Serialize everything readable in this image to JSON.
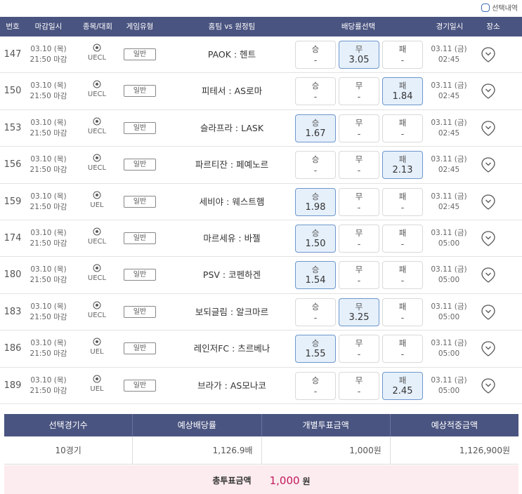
{
  "topbar": {
    "selection_label": "선택내역"
  },
  "header": {
    "no": "번호",
    "deadline": "마감일시",
    "sport": "종목/대회",
    "game_type": "게임유형",
    "teams": "홈팀 vs 원정팀",
    "odds": "배당률선택",
    "game_time": "경기일시",
    "venue": "장소"
  },
  "rows": [
    {
      "no": "147",
      "deadline_date": "03.10 (목)",
      "deadline_time": "21:50 마감",
      "league": "UECL",
      "type": "일반",
      "match": "PAOK : 헨트",
      "win_label": "승",
      "win_val": "-",
      "draw_label": "무",
      "draw_val": "3.05",
      "lose_label": "패",
      "lose_val": "-",
      "selected": "draw",
      "game_date": "03.11 (금)",
      "game_time": "02:45"
    },
    {
      "no": "150",
      "deadline_date": "03.10 (목)",
      "deadline_time": "21:50 마감",
      "league": "UECL",
      "type": "일반",
      "match": "피테서 : AS로마",
      "win_label": "승",
      "win_val": "-",
      "draw_label": "무",
      "draw_val": "-",
      "lose_label": "패",
      "lose_val": "1.84",
      "selected": "lose",
      "game_date": "03.11 (금)",
      "game_time": "02:45"
    },
    {
      "no": "153",
      "deadline_date": "03.10 (목)",
      "deadline_time": "21:50 마감",
      "league": "UECL",
      "type": "일반",
      "match": "슬라프라 : LASK",
      "win_label": "승",
      "win_val": "1.67",
      "draw_label": "무",
      "draw_val": "-",
      "lose_label": "패",
      "lose_val": "-",
      "selected": "win",
      "game_date": "03.11 (금)",
      "game_time": "02:45"
    },
    {
      "no": "156",
      "deadline_date": "03.10 (목)",
      "deadline_time": "21:50 마감",
      "league": "UECL",
      "type": "일반",
      "match": "파르티잔 : 페예노르",
      "win_label": "승",
      "win_val": "-",
      "draw_label": "무",
      "draw_val": "-",
      "lose_label": "패",
      "lose_val": "2.13",
      "selected": "lose",
      "game_date": "03.11 (금)",
      "game_time": "02:45"
    },
    {
      "no": "159",
      "deadline_date": "03.10 (목)",
      "deadline_time": "21:50 마감",
      "league": "UEL",
      "type": "일반",
      "match": "세비야 : 웨스트햄",
      "win_label": "승",
      "win_val": "1.98",
      "draw_label": "무",
      "draw_val": "-",
      "lose_label": "패",
      "lose_val": "-",
      "selected": "win",
      "game_date": "03.11 (금)",
      "game_time": "02:45"
    },
    {
      "no": "174",
      "deadline_date": "03.10 (목)",
      "deadline_time": "21:50 마감",
      "league": "UECL",
      "type": "일반",
      "match": "마르세유 : 바젤",
      "win_label": "승",
      "win_val": "1.50",
      "draw_label": "무",
      "draw_val": "-",
      "lose_label": "패",
      "lose_val": "-",
      "selected": "win",
      "game_date": "03.11 (금)",
      "game_time": "05:00"
    },
    {
      "no": "180",
      "deadline_date": "03.10 (목)",
      "deadline_time": "21:50 마감",
      "league": "UECL",
      "type": "일반",
      "match": "PSV : 코펜하겐",
      "win_label": "승",
      "win_val": "1.54",
      "draw_label": "무",
      "draw_val": "-",
      "lose_label": "패",
      "lose_val": "-",
      "selected": "win",
      "game_date": "03.11 (금)",
      "game_time": "05:00"
    },
    {
      "no": "183",
      "deadline_date": "03.10 (목)",
      "deadline_time": "21:50 마감",
      "league": "UECL",
      "type": "일반",
      "match": "보되글림 : 알크마르",
      "win_label": "승",
      "win_val": "-",
      "draw_label": "무",
      "draw_val": "3.25",
      "lose_label": "패",
      "lose_val": "-",
      "selected": "draw",
      "game_date": "03.11 (금)",
      "game_time": "05:00"
    },
    {
      "no": "186",
      "deadline_date": "03.10 (목)",
      "deadline_time": "21:50 마감",
      "league": "UEL",
      "type": "일반",
      "match": "레인저FC : 츠르베나",
      "win_label": "승",
      "win_val": "1.55",
      "draw_label": "무",
      "draw_val": "-",
      "lose_label": "패",
      "lose_val": "-",
      "selected": "win",
      "game_date": "03.11 (금)",
      "game_time": "05:00"
    },
    {
      "no": "189",
      "deadline_date": "03.10 (목)",
      "deadline_time": "21:50 마감",
      "league": "UEL",
      "type": "일반",
      "match": "브라가 : AS모나코",
      "win_label": "승",
      "win_val": "-",
      "draw_label": "무",
      "draw_val": "-",
      "lose_label": "패",
      "lose_val": "2.45",
      "selected": "lose",
      "game_date": "03.11 (금)",
      "game_time": "05:00"
    }
  ],
  "summary": {
    "head_games": "선택경기수",
    "head_odds": "예상배당률",
    "head_bet": "개별투표금액",
    "head_win": "예상적중금액",
    "games": "10경기",
    "odds": "1,126.9배",
    "bet": "1,000원",
    "win": "1,126,900원"
  },
  "total": {
    "label": "총투표금액",
    "amount": "1,000",
    "unit": "원"
  },
  "colors": {
    "header_bg": "#4a5480",
    "selected_bg": "#e6f0fb",
    "selected_border": "#6d96cc",
    "total_bg": "#fcecef",
    "total_amount": "#c2185b",
    "checkbox": "#3d6fb6"
  },
  "icons": {
    "sport": "soccer-ball-icon",
    "venue": "location-pin-icon"
  }
}
